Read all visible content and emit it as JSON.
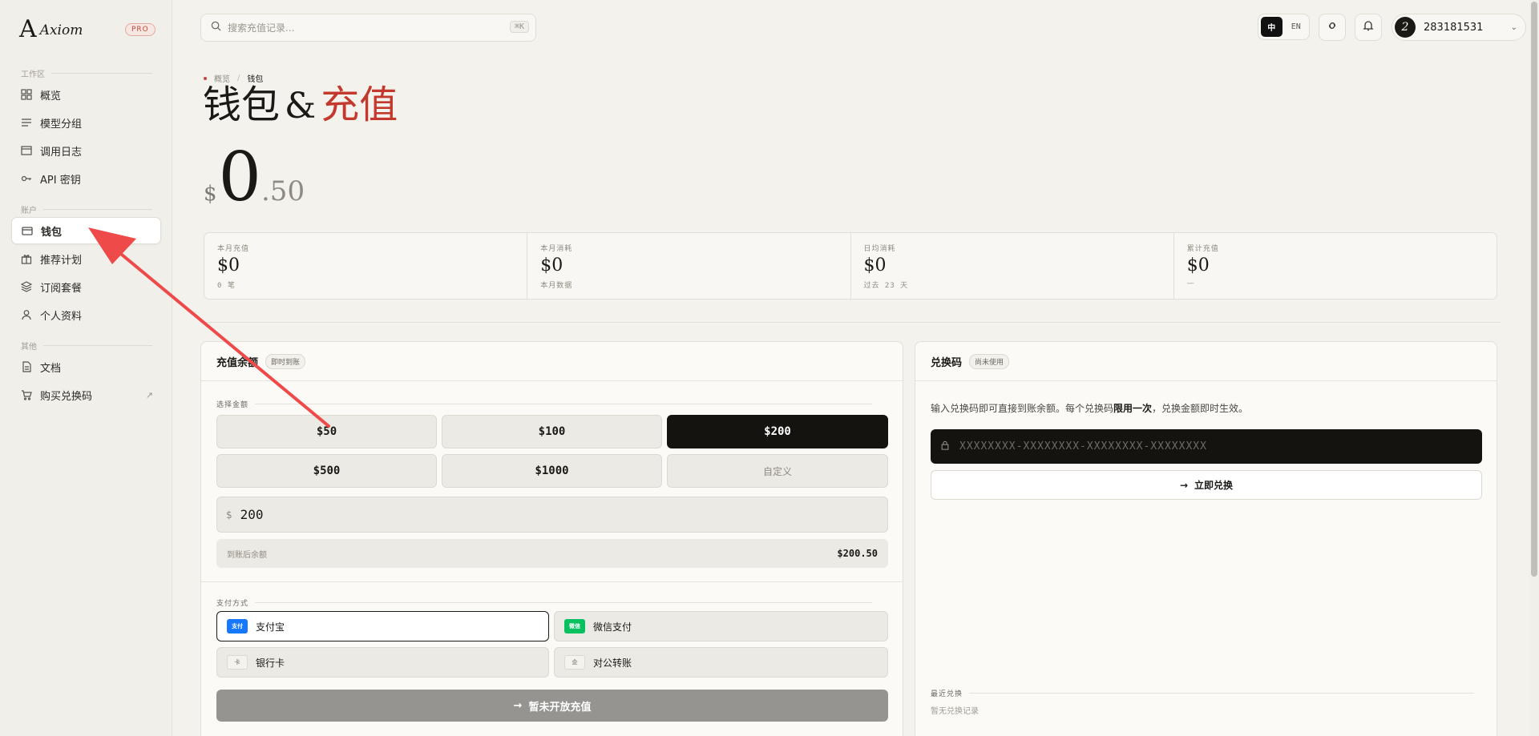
{
  "brand": {
    "name": "Axiom",
    "badge": "PRO"
  },
  "sidebar": {
    "sections": [
      "工作区",
      "账户",
      "其他"
    ],
    "items": [
      {
        "label": "概览",
        "icon": "grid-icon"
      },
      {
        "label": "模型分组",
        "icon": "list-icon"
      },
      {
        "label": "调用日志",
        "icon": "log-icon"
      },
      {
        "label": "API 密钥",
        "icon": "key-icon"
      },
      {
        "label": "钱包",
        "icon": "wallet-icon",
        "active": true
      },
      {
        "label": "推荐计划",
        "icon": "gift-icon"
      },
      {
        "label": "订阅套餐",
        "icon": "layers-icon"
      },
      {
        "label": "个人资料",
        "icon": "user-icon"
      },
      {
        "label": "文档",
        "icon": "doc-icon"
      },
      {
        "label": "购买兑换码",
        "icon": "cart-icon",
        "external": "↗"
      }
    ]
  },
  "topbar": {
    "search_placeholder": "搜索充值记录...",
    "search_shortcut": "⌘K",
    "lang_zh": "中",
    "lang_en": "EN",
    "user_id": "283181531",
    "avatar_letter": "2"
  },
  "page": {
    "breadcrumb": {
      "parent": "概览",
      "sep": "/",
      "current": "钱包"
    },
    "title_a": "钱包",
    "title_amp": "&",
    "title_b": "充值",
    "balance": {
      "currency": "$",
      "int": "0",
      "dec": ".50"
    }
  },
  "stats": [
    {
      "label": "本月充值",
      "value": "$0",
      "sub": "0 笔"
    },
    {
      "label": "本月消耗",
      "value": "$0",
      "sub": "本月数据"
    },
    {
      "label": "日均消耗",
      "value": "$0",
      "sub": "过去 23 天"
    },
    {
      "label": "累计充值",
      "value": "$0",
      "sub": "—"
    }
  ],
  "recharge": {
    "title": "充值余额",
    "badge": "即时到账",
    "select_label": "选择金额",
    "amounts": [
      "$50",
      "$100",
      "$200",
      "$500",
      "$1000",
      "自定义"
    ],
    "selected": "$200",
    "amount_prefix": "$",
    "amount_value": "200",
    "after_label": "到账后余额",
    "after_value": "$200.50",
    "pay_label": "支付方式",
    "methods": [
      {
        "label": "支付宝",
        "tag": "支付",
        "color": "#1677ff"
      },
      {
        "label": "微信支付",
        "tag": "微信",
        "color": "#07c160"
      },
      {
        "label": "银行卡",
        "tag": "卡",
        "color": ""
      },
      {
        "label": "对公转账",
        "tag": "企",
        "color": ""
      }
    ],
    "selected_method": "支付宝",
    "submit": "暂未开放充值"
  },
  "redeem": {
    "title": "兑换码",
    "badge": "尚未使用",
    "desc_a": "输入兑换码即可直接到账余额。每个兑换码",
    "desc_b": "限用一次",
    "desc_c": "，兑换金额即时生效。",
    "placeholder": "XXXXXXXX-XXXXXXXX-XXXXXXXX-XXXXXXXX",
    "button": "立即兑换",
    "recent_label": "最近兑换",
    "empty": "暂无兑换记录"
  },
  "colors": {
    "accent": "#c4392d",
    "annotation": "#ee4a4a",
    "dark": "#141310"
  }
}
